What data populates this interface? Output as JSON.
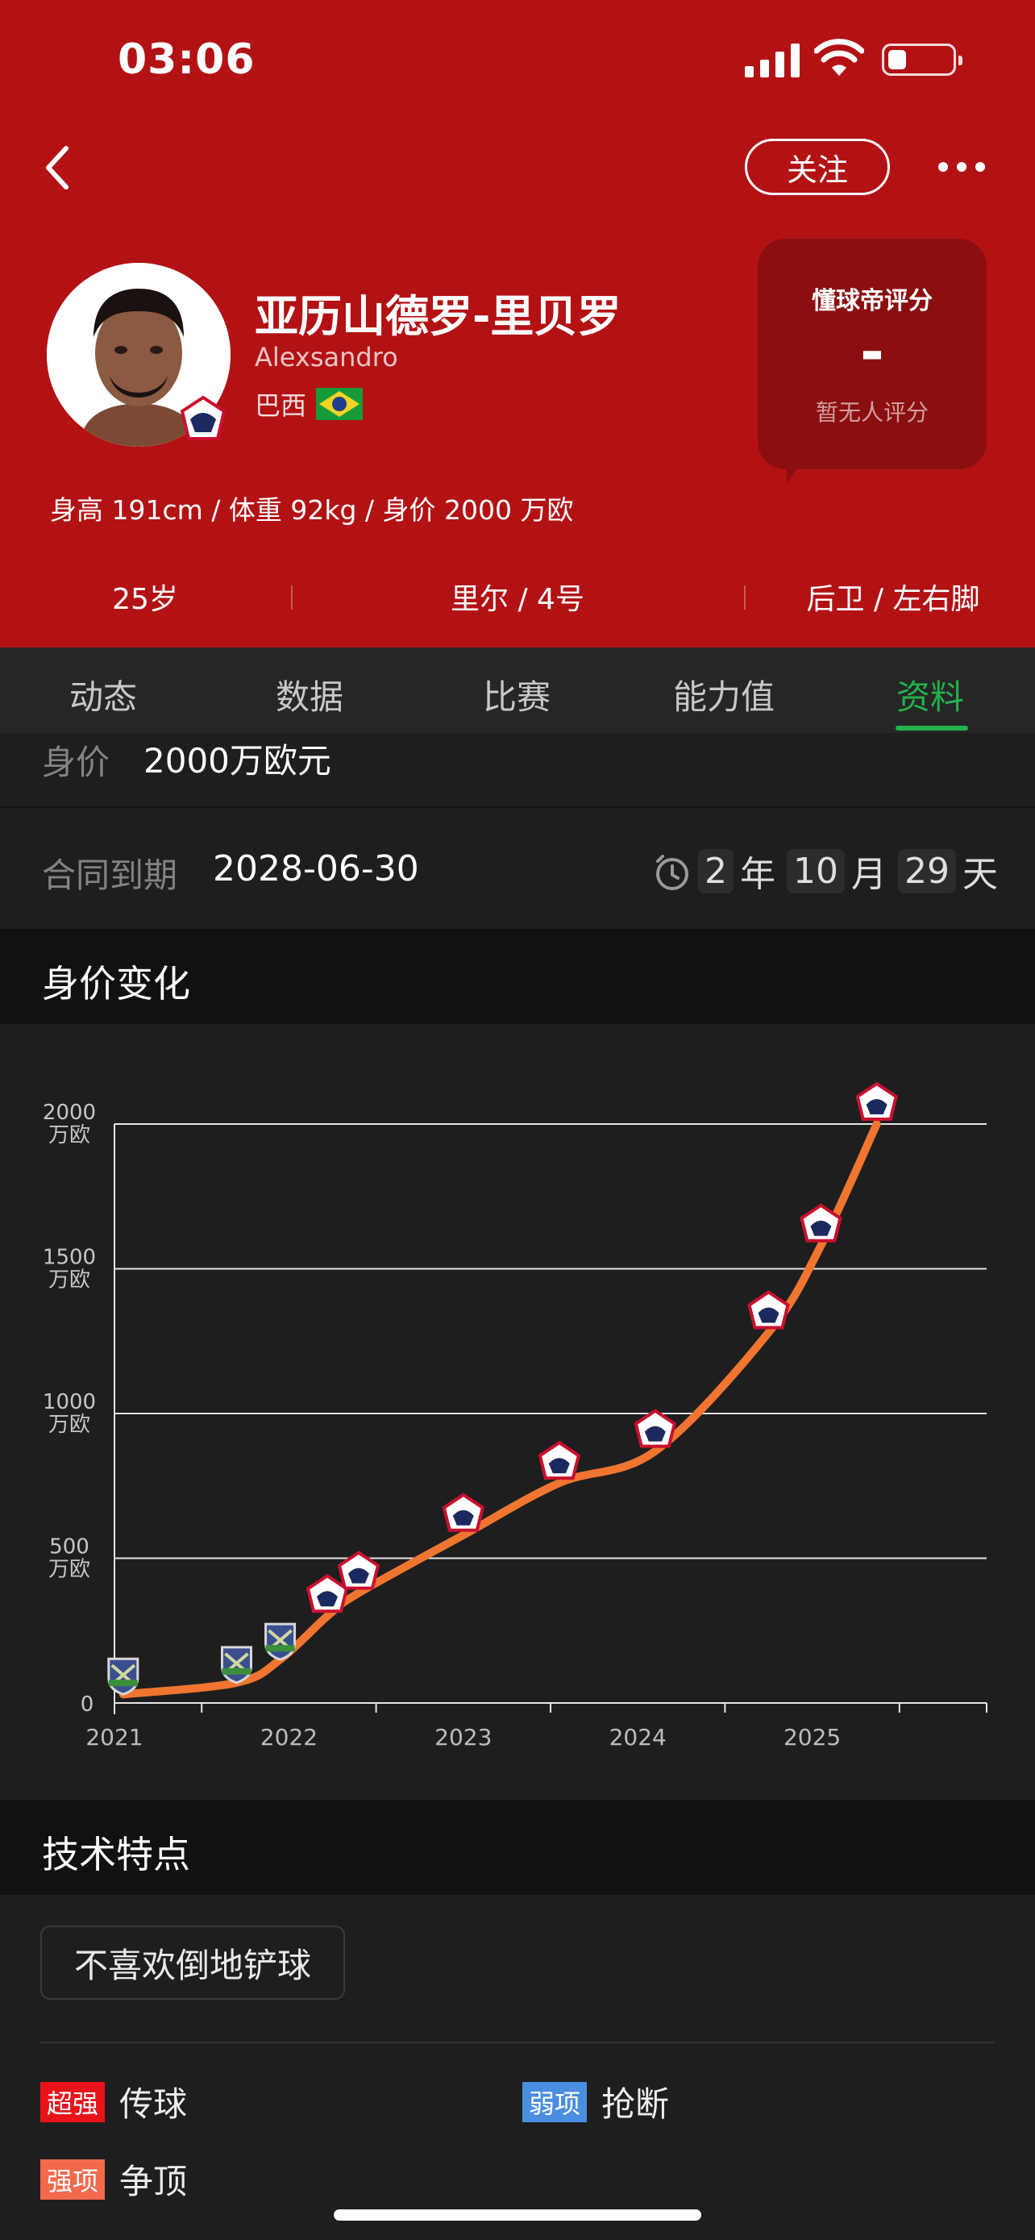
{
  "status_bar": {
    "time": "03:06"
  },
  "header": {
    "follow_label": "关注",
    "player_name": "亚历山德罗-里贝罗",
    "player_name_latin": "Alexsandro",
    "nationality": "巴西",
    "rating": {
      "title": "懂球帝评分",
      "value": "-",
      "subtitle": "暂无人评分"
    },
    "body_stats": "身高 191cm / 体重 92kg / 身价 2000 万欧",
    "age": "25岁",
    "club_number": "里尔 / 4号",
    "position_foot": "后卫 / 左右脚"
  },
  "tabs": [
    {
      "label": "动态"
    },
    {
      "label": "数据"
    },
    {
      "label": "比赛"
    },
    {
      "label": "能力值"
    },
    {
      "label": "资料",
      "active": true
    }
  ],
  "profile": {
    "value_label": "身价",
    "value_text": "2000万欧元",
    "contract_label": "合同到期",
    "contract_date": "2028-06-30",
    "countdown": {
      "years": "2",
      "year_unit": "年",
      "months": "10",
      "month_unit": "月",
      "days": "29",
      "day_unit": "天"
    }
  },
  "value_section": {
    "title": "身价变化"
  },
  "chart_data": {
    "type": "line",
    "x": [
      2020.55,
      2021.2,
      2021.45,
      2021.72,
      2021.9,
      2022.5,
      2023.05,
      2023.6,
      2024.25,
      2024.55,
      2024.87
    ],
    "values": [
      30,
      70,
      150,
      300,
      380,
      580,
      760,
      870,
      1280,
      1580,
      2000
    ],
    "clubs": [
      "Chaves",
      "Chaves",
      "Chaves",
      "Lille",
      "Lille",
      "Lille",
      "Lille",
      "Lille",
      "Lille",
      "Lille",
      "Lille"
    ],
    "yticks": [
      {
        "value": 0,
        "label": "0"
      },
      {
        "value": 500,
        "label": "500万欧"
      },
      {
        "value": 1000,
        "label": "1000万欧"
      },
      {
        "value": 1500,
        "label": "1500万欧"
      },
      {
        "value": 2000,
        "label": "2000万欧"
      }
    ],
    "xticks": [
      "2021",
      "2022",
      "2023",
      "2024",
      "2025"
    ],
    "xlim": [
      2020.5,
      2025.5
    ],
    "ylim": [
      0,
      2000
    ],
    "line_color": "#f07530",
    "grid": true
  },
  "traits_section": {
    "title": "技术特点",
    "chip": "不喜欢倒地铲球",
    "skills": [
      {
        "tag": "超强",
        "name": "传球",
        "tag_color": "#e8141a"
      },
      {
        "tag": "弱项",
        "name": "抢断",
        "tag_color": "#4a8ee0"
      },
      {
        "tag": "强项",
        "name": "争顶",
        "tag_color": "#f26a4b"
      }
    ]
  }
}
